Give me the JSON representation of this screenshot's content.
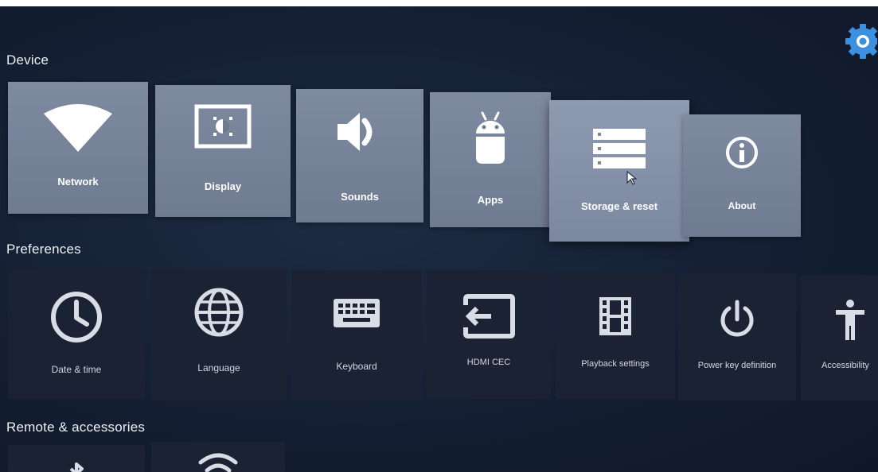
{
  "sections": {
    "device": "Device",
    "preferences": "Preferences",
    "remote": "Remote & accessories"
  },
  "device_tiles": [
    {
      "label": "Network",
      "icon": "wifi-icon"
    },
    {
      "label": "Display",
      "icon": "display-icon"
    },
    {
      "label": "Sounds",
      "icon": "speaker-icon"
    },
    {
      "label": "Apps",
      "icon": "android-icon"
    },
    {
      "label": "Storage & reset",
      "icon": "storage-icon"
    },
    {
      "label": "About",
      "icon": "info-icon"
    }
  ],
  "preference_tiles": [
    {
      "label": "Date & time",
      "icon": "clock-icon"
    },
    {
      "label": "Language",
      "icon": "globe-icon"
    },
    {
      "label": "Keyboard",
      "icon": "keyboard-icon"
    },
    {
      "label": "HDMI CEC",
      "icon": "input-icon"
    },
    {
      "label": "Playback settings",
      "icon": "film-icon"
    },
    {
      "label": "Power key definition",
      "icon": "power-icon"
    },
    {
      "label": "Accessibility",
      "icon": "accessibility-icon"
    }
  ],
  "remote_tiles": [
    {
      "icon": "bluetooth-icon"
    },
    {
      "icon": "wifi-signal-icon"
    }
  ],
  "colors": {
    "background": "#141f33",
    "device_tile": "#7e8aa0",
    "pref_tile": "#1a2233",
    "settings_accent": "#3d8fe0"
  }
}
